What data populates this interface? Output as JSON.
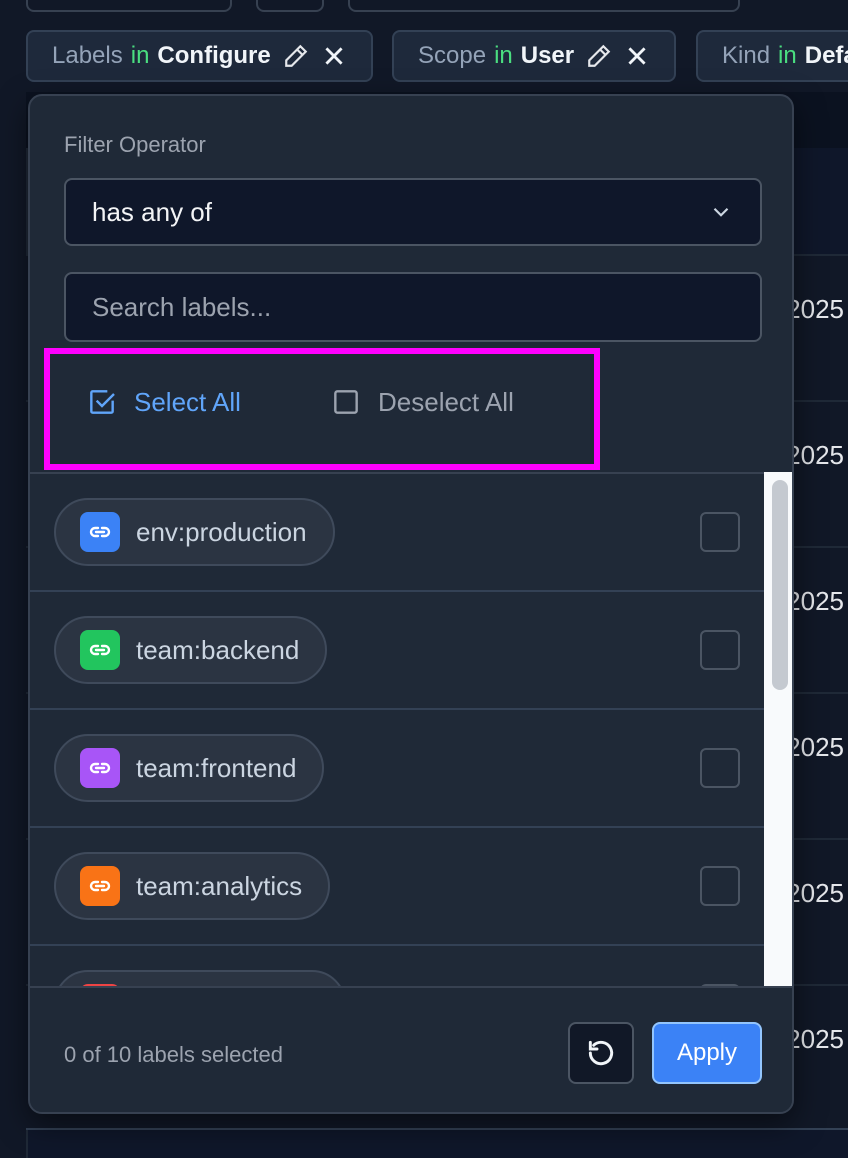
{
  "filter_chips": [
    {
      "field": "Labels",
      "operator": "in",
      "value": "Configure"
    },
    {
      "field": "Scope",
      "operator": "in",
      "value": "User"
    },
    {
      "field": "Kind",
      "operator": "in",
      "value": "Defa"
    }
  ],
  "background_dates": [
    "2025",
    "2025",
    "2025",
    "2025",
    "2025",
    "2025"
  ],
  "popover": {
    "operator_label": "Filter Operator",
    "operator_value": "has any of",
    "search_placeholder": "Search labels...",
    "search_value": "",
    "select_all_label": "Select All",
    "deselect_all_label": "Deselect All",
    "labels": [
      {
        "name": "env:production",
        "color": "#3b82f6",
        "checked": false
      },
      {
        "name": "team:backend",
        "color": "#22c55e",
        "checked": false
      },
      {
        "name": "team:frontend",
        "color": "#a855f7",
        "checked": false
      },
      {
        "name": "team:analytics",
        "color": "#f97316",
        "checked": false
      },
      {
        "name": "",
        "color": "#ef4444",
        "checked": false
      }
    ],
    "selected_count_text": "0 of 10 labels selected",
    "apply_label": "Apply"
  },
  "colors": {
    "accent": "#3b82f6",
    "highlight": "#ff00ff",
    "in_keyword": "#4ade80"
  }
}
